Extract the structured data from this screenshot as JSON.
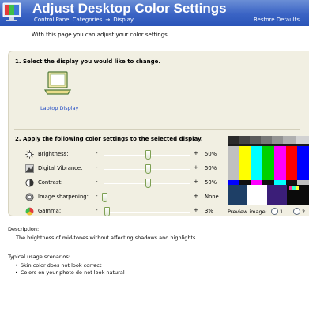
{
  "header": {
    "title": "Adjust Desktop Color Settings",
    "breadcrumb": [
      "Control Panel Categories",
      "Display"
    ],
    "breadcrumb_separator": "→",
    "restore_defaults": "Restore Defaults",
    "icon": "display-settings-icon"
  },
  "intro": "With this page you can adjust your color settings",
  "step1": {
    "title": "1. Select the display you would like to change.",
    "displays": [
      {
        "label": "Laptop Display",
        "icon": "laptop-icon"
      }
    ]
  },
  "step2": {
    "title": "2. Apply the following color settings to the selected display.",
    "settings": [
      {
        "label": "Brightness:",
        "minus": "-",
        "plus": "+",
        "value": "50%",
        "level": 0.5,
        "icon": "sun-icon"
      },
      {
        "label": "Digital Vibrance:",
        "minus": "-",
        "plus": "+",
        "value": "50%",
        "level": 0.5,
        "icon": "vibrance-icon"
      },
      {
        "label": "Contrast:",
        "minus": "-",
        "plus": "+",
        "value": "50%",
        "level": 0.5,
        "icon": "contrast-icon"
      },
      {
        "label": "Image sharpening:",
        "minus": "-",
        "plus": "+",
        "value": "None",
        "level": 0.0,
        "icon": "sharpening-icon"
      },
      {
        "label": "Gamma:",
        "minus": "-",
        "plus": "+",
        "value": "3%",
        "level": 0.03,
        "icon": "gamma-icon"
      }
    ]
  },
  "preview": {
    "label": "Preview image:",
    "options": [
      {
        "label": "1",
        "selected": false
      },
      {
        "label": "2",
        "selected": false
      }
    ]
  },
  "description": {
    "title": "Description:",
    "text": "The brightness of mid-tones without affecting shadows and highlights."
  },
  "usage": {
    "title": "Typical usage scenarios:",
    "items": [
      "Skin color does not look correct",
      "Colors on your photo do not look natural"
    ]
  },
  "colors": {
    "header_top": "#6a8ed6",
    "header_bottom": "#2b55b8",
    "panel_bg": "#f1efe2",
    "link": "#2b53c6"
  }
}
